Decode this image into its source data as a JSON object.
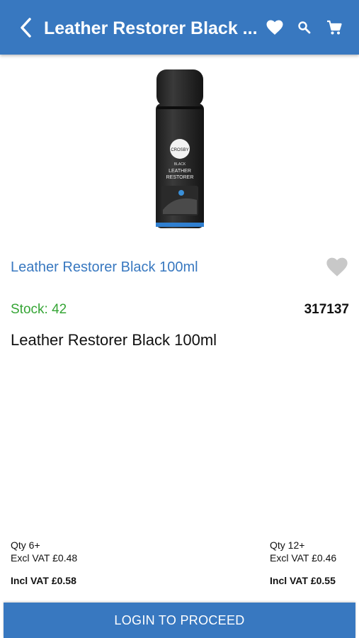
{
  "header": {
    "title": "Leather Restorer Black ...",
    "icons": [
      "back-arrow-icon",
      "heart-icon",
      "search-icon",
      "cart-icon"
    ],
    "background_color": "#3878c0"
  },
  "product_image": {
    "brand": "CROSBY",
    "variant": "BLACK",
    "line1": "LEATHER",
    "line2": "RESTORER"
  },
  "product": {
    "title": "Leather Restorer Black 100ml",
    "stock_label": "Stock: 42",
    "sku": "317137",
    "description": "Leather Restorer Black 100ml"
  },
  "pricing": {
    "tier1": {
      "qty": "Qty 6+",
      "excl": "Excl VAT £0.48",
      "incl": "Incl VAT £0.58"
    },
    "tier2": {
      "qty": "Qty 12+",
      "excl": "Excl VAT £0.46",
      "incl": "Incl VAT £0.55"
    }
  },
  "actions": {
    "login_label": "LOGIN TO PROCEED"
  },
  "colors": {
    "accent": "#3878c0",
    "stock": "#35a535",
    "favorite_inactive": "#c8c8c8"
  }
}
